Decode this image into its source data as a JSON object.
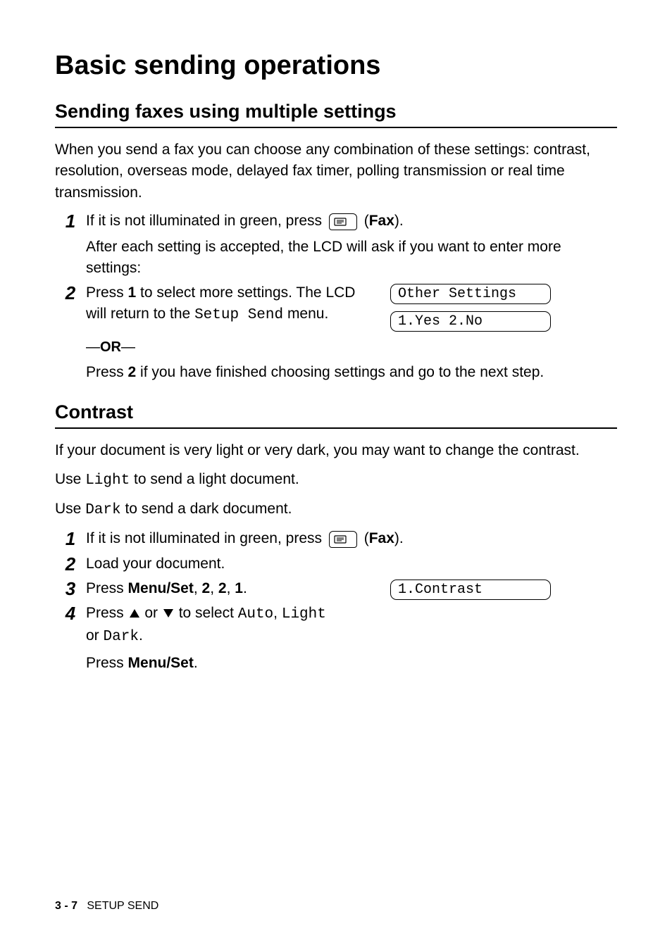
{
  "title": "Basic sending operations",
  "section1": {
    "heading": "Sending faxes using multiple settings",
    "intro": "When you send a fax you can choose any combination of these settings: contrast, resolution, overseas mode, delayed fax timer, polling transmission or real time transmission.",
    "step1": {
      "num": "1",
      "text_a": "If it is not illuminated in green, press ",
      "fax_label": "Fax",
      "text_b": ").",
      "after": "After each setting is accepted, the LCD will ask if you want to enter more settings:"
    },
    "step2": {
      "num": "2",
      "text_a": "Press ",
      "key1": "1",
      "text_b": " to select more settings. The LCD will return to the ",
      "mono1": "Setup Send",
      "text_c": " menu.",
      "or": "—OR—",
      "text_d": "Press ",
      "key2": "2",
      "text_e": " if you have finished choosing settings and go to the next step.",
      "lcd1": "Other Settings",
      "lcd2": "1.Yes 2.No"
    }
  },
  "section2": {
    "heading": "Contrast",
    "intro": "If your document is very light or very dark, you may want to change the contrast.",
    "use_light_a": "Use ",
    "use_light_mono": "Light",
    "use_light_b": " to send a light document.",
    "use_dark_a": "Use ",
    "use_dark_mono": "Dark",
    "use_dark_b": " to send a dark document.",
    "step1": {
      "num": "1",
      "text_a": "If it is not illuminated in green, press ",
      "fax_label": "Fax",
      "text_b": ")."
    },
    "step2": {
      "num": "2",
      "text": "Load your document."
    },
    "step3": {
      "num": "3",
      "text_a": "Press ",
      "menu": "Menu/Set",
      "sep": ", ",
      "k1": "2",
      "k2": "2",
      "k3": "1",
      "period": ".",
      "lcd": "1.Contrast"
    },
    "step4": {
      "num": "4",
      "text_a": "Press ",
      "text_b": " or ",
      "text_c": " to select ",
      "auto": "Auto",
      "sep1": ", ",
      "light": "Light",
      "text_d": " or ",
      "dark": "Dark",
      "period": ".",
      "press": "Press ",
      "menu": "Menu/Set",
      "period2": "."
    }
  },
  "footer": {
    "page": "3 - 7",
    "label": "SETUP SEND"
  }
}
